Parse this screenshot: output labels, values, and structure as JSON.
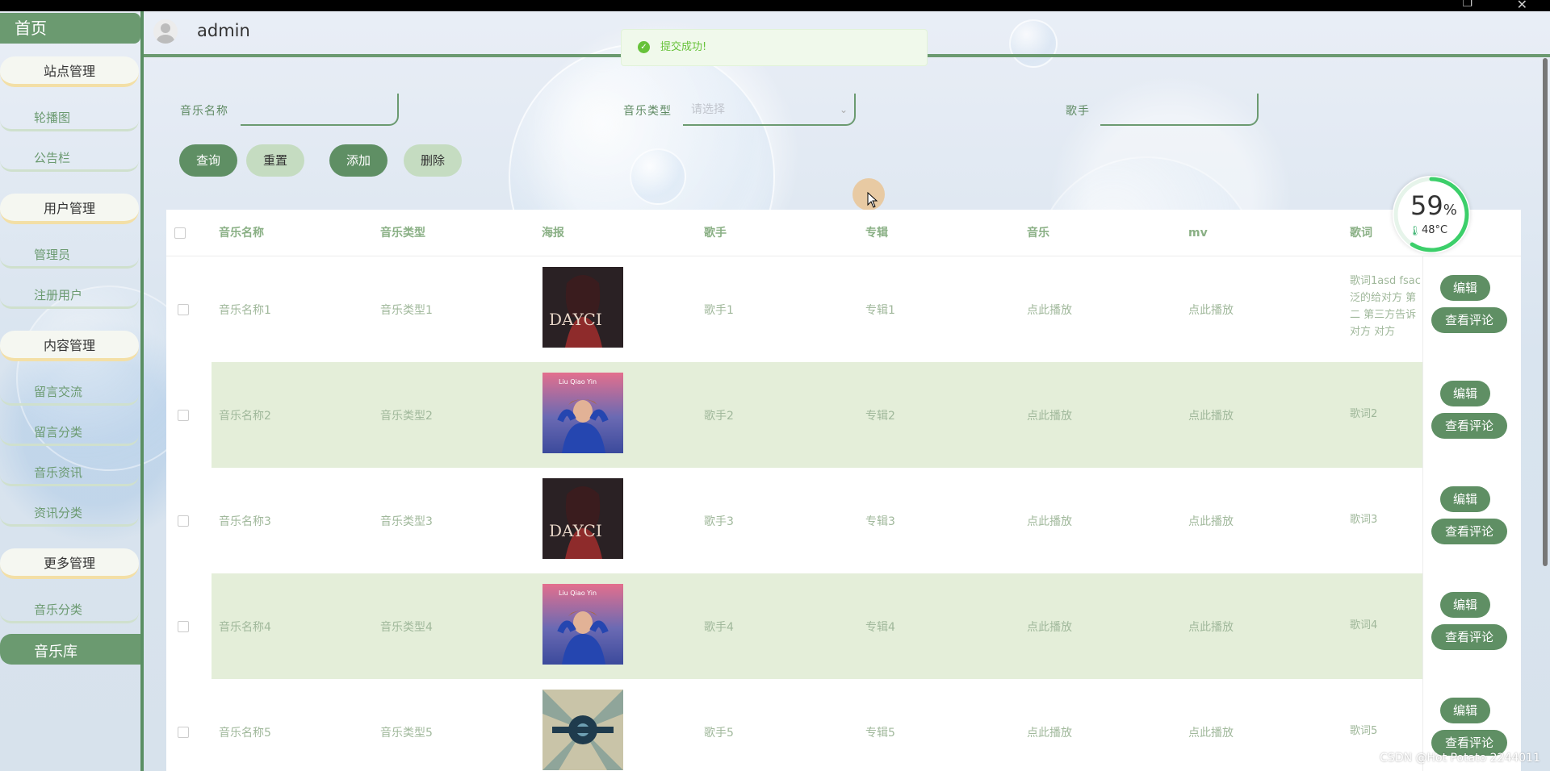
{
  "sidebar": {
    "home": "首页",
    "groups": [
      {
        "title": "站点管理",
        "items": [
          "轮播图",
          "公告栏"
        ]
      },
      {
        "title": "用户管理",
        "items": [
          "管理员",
          "注册用户"
        ]
      },
      {
        "title": "内容管理",
        "items": [
          "留言交流",
          "留言分类",
          "音乐资讯",
          "资讯分类"
        ]
      },
      {
        "title": "更多管理",
        "items": [
          "音乐分类"
        ]
      }
    ],
    "library": "音乐库"
  },
  "header": {
    "username": "admin"
  },
  "toast": {
    "message": "提交成功!"
  },
  "search": {
    "name_label": "音乐名称",
    "type_label": "音乐类型",
    "type_placeholder": "请选择",
    "singer_label": "歌手",
    "query": "查询",
    "reset": "重置",
    "add": "添加",
    "delete": "删除"
  },
  "gauge": {
    "percent": "59",
    "unit": "%",
    "temp": "48°C"
  },
  "table": {
    "headers": [
      "音乐名称",
      "音乐类型",
      "海报",
      "歌手",
      "专辑",
      "音乐",
      "mv",
      "歌词"
    ],
    "rows": [
      {
        "name": "音乐名称1",
        "type": "音乐类型1",
        "singer": "歌手1",
        "album": "专辑1",
        "music": "点此播放",
        "mv": "点此播放",
        "lyric": "歌词1asd fsac 泛的给对方 第二 第三方告诉对方 对方"
      },
      {
        "name": "音乐名称2",
        "type": "音乐类型2",
        "singer": "歌手2",
        "album": "专辑2",
        "music": "点此播放",
        "mv": "点此播放",
        "lyric": "歌词2"
      },
      {
        "name": "音乐名称3",
        "type": "音乐类型3",
        "singer": "歌手3",
        "album": "专辑3",
        "music": "点此播放",
        "mv": "点此播放",
        "lyric": "歌词3"
      },
      {
        "name": "音乐名称4",
        "type": "音乐类型4",
        "singer": "歌手4",
        "album": "专辑4",
        "music": "点此播放",
        "mv": "点此播放",
        "lyric": "歌词4"
      },
      {
        "name": "音乐名称5",
        "type": "音乐类型5",
        "singer": "歌手5",
        "album": "专辑5",
        "music": "点此播放",
        "mv": "点此播放",
        "lyric": "歌词5"
      }
    ],
    "edit": "编辑",
    "comments": "查看评论"
  },
  "watermark": "CSDN @Hot Potato 2244011",
  "colors": {
    "primary": "#5f8f64",
    "light": "#c5dcc1",
    "row_alt": "#e4eed9",
    "toast_bg": "#f0f9eb"
  }
}
